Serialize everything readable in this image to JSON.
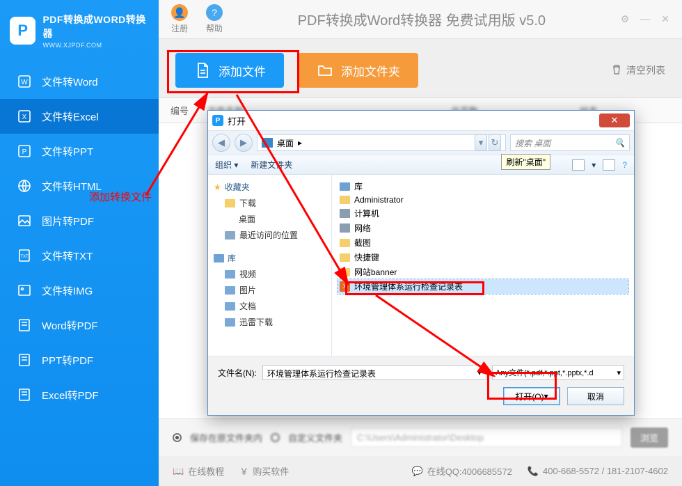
{
  "app": {
    "logo_title": "PDF转换成WORD转换器",
    "logo_sub": "WWW.XJPDF.COM",
    "title": "PDF转换成Word转换器 免费试用版 v5.0"
  },
  "topbar": {
    "register": "注册",
    "help": "帮助"
  },
  "sidebar": {
    "items": [
      {
        "label": "文件转Word"
      },
      {
        "label": "文件转Excel"
      },
      {
        "label": "文件转PPT"
      },
      {
        "label": "文件转HTML"
      },
      {
        "label": "图片转PDF"
      },
      {
        "label": "文件转TXT"
      },
      {
        "label": "文件转IMG"
      },
      {
        "label": "Word转PDF"
      },
      {
        "label": "PPT转PDF"
      },
      {
        "label": "Excel转PDF"
      }
    ],
    "active_index": 1
  },
  "actions": {
    "add_file": "添加文件",
    "add_folder": "添加文件夹",
    "clear_list": "清空列表"
  },
  "table": {
    "idx_header": "编号",
    "name_header": "文件名称",
    "pages_header": "总页数",
    "status_header": "状态"
  },
  "save": {
    "opt_original": "保存在原文件夹内",
    "opt_custom": "自定义文件夹",
    "path_value": "C:\\Users\\Administrator\\Desktop",
    "browse": "浏览"
  },
  "footer": {
    "tutorial": "在线教程",
    "buy": "购买软件",
    "qq_label": "在线QQ:4006685572",
    "phone": "400-668-5572 / 181-2107-4602"
  },
  "dialog": {
    "title": "打开",
    "crumb_location": "桌面",
    "search_placeholder": "搜索 桌面",
    "refresh_tooltip": "刷新\"桌面\"",
    "toolbar_organize": "组织",
    "toolbar_newfolder": "新建文件夹",
    "side": {
      "favorites": "收藏夹",
      "downloads": "下载",
      "desktop": "桌面",
      "recent": "最近访问的位置",
      "libraries": "库",
      "videos": "视频",
      "pictures": "图片",
      "documents": "文档",
      "xunlei": "迅雷下载"
    },
    "files": {
      "libraries": "库",
      "admin": "Administrator",
      "computer": "计算机",
      "network": "网络",
      "screenshot": "截图",
      "shortcut": "快捷键",
      "banner": "网站banner",
      "selected": "环境管理体系运行检查记录表"
    },
    "filename_label": "文件名(N):",
    "filename_value": "环境管理体系运行检查记录表",
    "filetype": "Any文件(*.pdf,*.ppt,*.pptx,*.d",
    "open_btn": "打开(O)",
    "cancel_btn": "取消"
  },
  "annotation": {
    "label": "添加转换文件"
  }
}
